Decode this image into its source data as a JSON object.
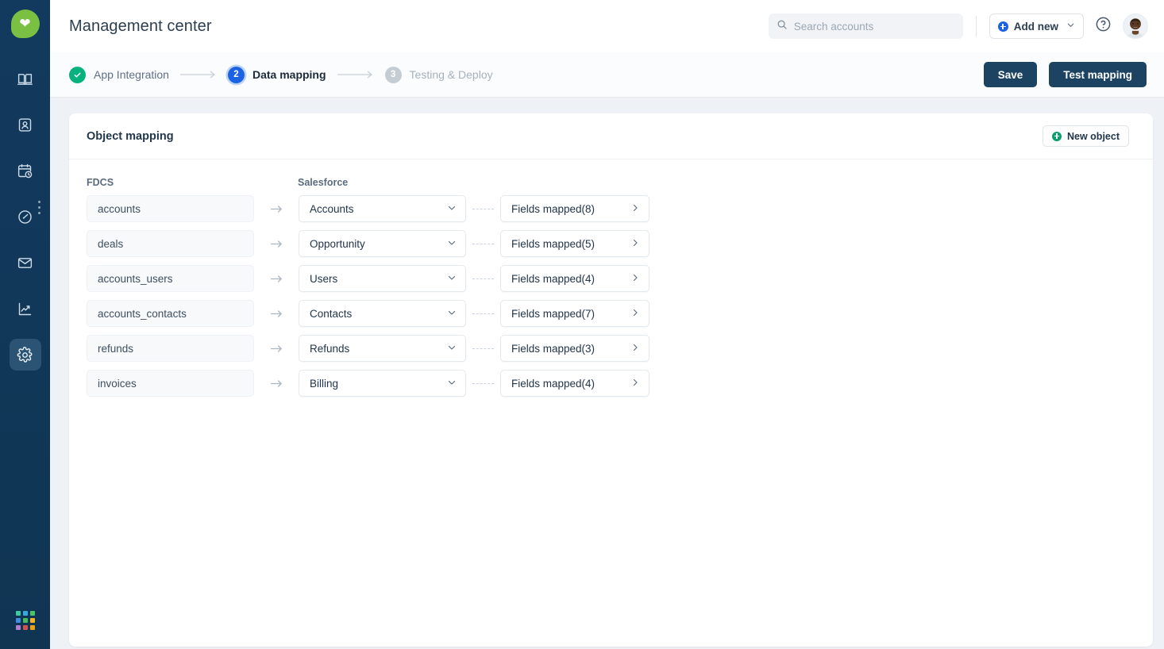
{
  "sidebar": {
    "logo": {
      "icon": "heart-leaf-logo"
    },
    "items": [
      {
        "icon": "book-icon",
        "name": "sidebar-item-book",
        "active": false
      },
      {
        "icon": "contact-person-icon",
        "name": "sidebar-item-contacts",
        "active": false
      },
      {
        "icon": "calendar-clock-icon",
        "name": "sidebar-item-schedule",
        "active": false
      },
      {
        "icon": "gauge-icon",
        "name": "sidebar-item-performance",
        "active": false
      },
      {
        "icon": "envelope-icon",
        "name": "sidebar-item-mail",
        "active": false
      },
      {
        "icon": "trending-chart-icon",
        "name": "sidebar-item-analytics",
        "active": false
      },
      {
        "icon": "gear-icon",
        "name": "sidebar-item-settings",
        "active": true
      }
    ],
    "handle_icon": "more-vertical-icon",
    "app_grid": {
      "icon": "app-grid-icon",
      "colors": [
        "#3fc9a0",
        "#35a9e0",
        "#4cc26a",
        "#3f8ddb",
        "#45bd5f",
        "#f0b429",
        "#b07fd0",
        "#d8504a",
        "#e8a317"
      ]
    }
  },
  "header": {
    "title": "Management center",
    "search": {
      "placeholder": "Search accounts",
      "value": "",
      "icon": "search-icon"
    },
    "add_new": {
      "label": "Add new",
      "icon": "plus-circle-icon",
      "chevron": "chevron-down-icon",
      "accent": "#1b63e3"
    },
    "help": {
      "icon": "help-circle-icon"
    },
    "avatar": {
      "icon": "user-avatar"
    }
  },
  "stepper": {
    "steps": [
      {
        "marker": "✓",
        "label": "App Integration",
        "state": "done",
        "color": "#07b27e"
      },
      {
        "marker": "2",
        "label": "Data mapping",
        "state": "current",
        "color": "#1b63e3"
      },
      {
        "marker": "3",
        "label": "Testing & Deploy",
        "state": "pending",
        "color": "#c4ccd4"
      }
    ],
    "arrow": "⟶",
    "actions": {
      "save": "Save",
      "test": "Test mapping"
    }
  },
  "object_mapping": {
    "title": "Object mapping",
    "new_object": {
      "label": "New object",
      "icon": "plus-circle-icon",
      "accent": "#0aa06e"
    },
    "columns": {
      "source": "FDCS",
      "target": "Salesforce"
    },
    "row_arrow": "→",
    "chevron_right": "›",
    "chevron_down": "⌄",
    "rows": [
      {
        "source": "accounts",
        "target": "Accounts",
        "fields": "Fields mapped(8)",
        "count": 8
      },
      {
        "source": "deals",
        "target": "Opportunity",
        "fields": "Fields mapped(5)",
        "count": 5
      },
      {
        "source": "accounts_users",
        "target": "Users",
        "fields": "Fields mapped(4)",
        "count": 4
      },
      {
        "source": "accounts_contacts",
        "target": "Contacts",
        "fields": "Fields mapped(7)",
        "count": 7
      },
      {
        "source": "refunds",
        "target": "Refunds",
        "fields": "Fields mapped(3)",
        "count": 3
      },
      {
        "source": "invoices",
        "target": "Billing",
        "fields": "Fields mapped(4)",
        "count": 4
      }
    ]
  }
}
